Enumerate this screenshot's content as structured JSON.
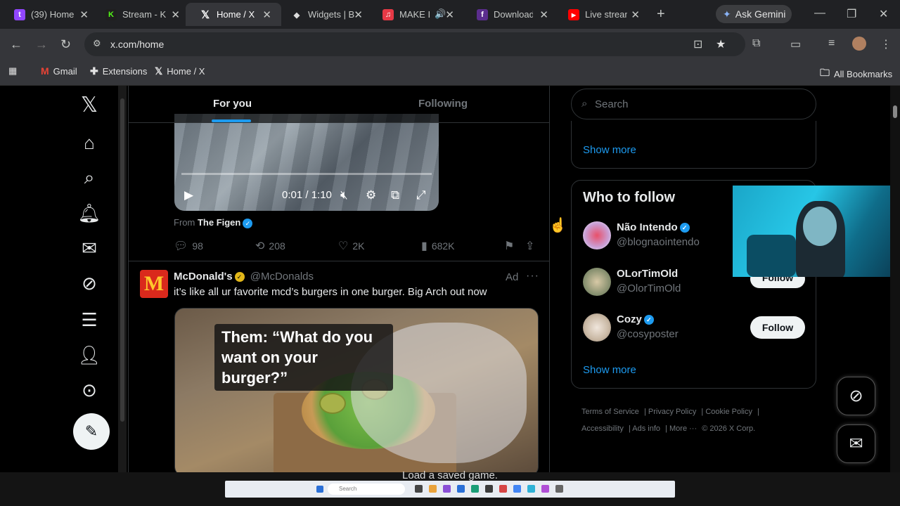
{
  "browser": {
    "tabs": [
      {
        "label": "(39) Home",
        "icon": "twitch-icon",
        "color": "#9146ff",
        "glyph": "t"
      },
      {
        "label": "Stream - K",
        "icon": "kick-icon",
        "color": "#53fc18",
        "glyph": "K"
      },
      {
        "label": "Home / X",
        "icon": "x-icon",
        "color": "#000000",
        "glyph": "X"
      },
      {
        "label": "Widgets | B",
        "icon": "widget-icon",
        "color": "#555555",
        "glyph": "◆"
      },
      {
        "label": "MAKE I",
        "icon": "music-icon",
        "color": "#e63946",
        "glyph": "♫"
      },
      {
        "label": "Download",
        "icon": "download-site-icon",
        "color": "#5b2d8e",
        "glyph": "f"
      },
      {
        "label": "Live stream",
        "icon": "youtube-icon",
        "color": "#ff0000",
        "glyph": "▶"
      }
    ],
    "gemini_label": "Ask Gemini",
    "url": "x.com/home",
    "bookmarks": [
      "Gmail",
      "Extensions",
      "Home / X"
    ],
    "all_bookmarks": "All Bookmarks"
  },
  "timeline": {
    "tab_for_you": "For you",
    "tab_following": "Following",
    "video": {
      "time": "0:01 / 1:10"
    },
    "from_prefix": "From",
    "from_name": "The Figen",
    "actions": {
      "replies": "98",
      "reposts": "208",
      "likes": "2K",
      "views": "682K"
    },
    "ad_post": {
      "name": "McDonald's",
      "handle": "@McDonalds",
      "ad_label": "Ad",
      "text": "it’s like all ur favorite mcd’s burgers in one burger. Big Arch out now",
      "caption": "Them: “What do you want on your burger?”"
    }
  },
  "sidebar": {
    "search_placeholder": "Search",
    "show_more_top": "Show more",
    "who_to_follow_title": "Who to follow",
    "people": [
      {
        "name": "Não Intendo",
        "handle": "@blognaointendo",
        "verified": true,
        "follow": ""
      },
      {
        "name": "OLorTimOld",
        "handle": "@OlorTimOld",
        "verified": false,
        "follow": "Follow"
      },
      {
        "name": "Cozy",
        "handle": "@cosyposter",
        "verified": true,
        "follow": "Follow"
      }
    ],
    "show_more_bottom": "Show more",
    "footer": [
      "Terms of Service",
      "Privacy Policy",
      "Cookie Policy",
      "Accessibility",
      "Ads info",
      "More ···",
      "© 2026 X Corp."
    ]
  },
  "overlay": {
    "subtitle": "Load a saved game.",
    "taskbar_search": "Search"
  }
}
